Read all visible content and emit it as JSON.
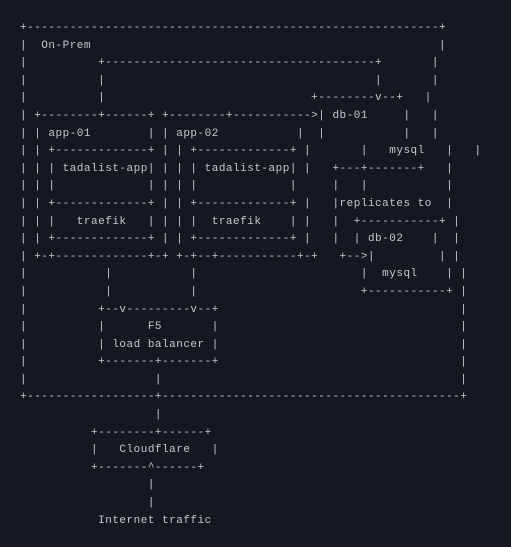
{
  "diagram": {
    "zone_label": "On-Prem",
    "app_server_1": {
      "hostname": "app-01",
      "app_name": "tadalist-app",
      "proxy": "traefik"
    },
    "app_server_2": {
      "hostname": "app-02",
      "app_name": "tadalist-app",
      "proxy": "traefik"
    },
    "db_primary": {
      "hostname": "db-01",
      "engine": "mysql",
      "replication_label": "replicates to"
    },
    "db_replica": {
      "hostname": "db-02",
      "engine": "mysql"
    },
    "load_balancer": {
      "name": "F5",
      "label": "load balancer"
    },
    "cdn": {
      "name": "Cloudflare"
    },
    "ingress_label": "Internet traffic"
  },
  "ascii_lines": [
    "+----------------------------------------------------------+",
    "|  On-Prem                                                 |",
    "|          +--------------------------------------+       |",
    "|          |                                      |       |",
    "|          |                             +--------v--+   |",
    "| +--------+------+ +--------+----------->| db-01     |   |",
    "| | app-01        | | app-02           |  |           |   |",
    "| | +-------------+ | | +-------------+ |       |   mysql   |   |",
    "| | | tadalist-app| | | | tadalist-app| |   +---+-------+   |",
    "| | |             | | | |             |     |   |           |",
    "| | +-------------+ | | +-------------+ |   |replicates to  |",
    "| | |   traefik   | | | |  traefik    | |   |  +-----------+ |",
    "| | +-------------+ | | +-------------+ |   |  | db-02    |  |",
    "| +-+-------------+-+ +-+--+-----------+-+   +-->|         | |",
    "|           |           |                       |  mysql    | |",
    "|           |           |                       +-----------+ |",
    "|          +--v---------v--+                                  |",
    "|          |      F5       |                                  |",
    "|          | load balancer |                                  |",
    "|          +-------+-------+                                  |",
    "|                  |                                          |",
    "+------------------+------------------------------------------+",
    "                   |",
    "          +--------+------+",
    "          |   Cloudflare   |",
    "          +-------^------+",
    "                  |",
    "                  |",
    "           Internet traffic"
  ]
}
